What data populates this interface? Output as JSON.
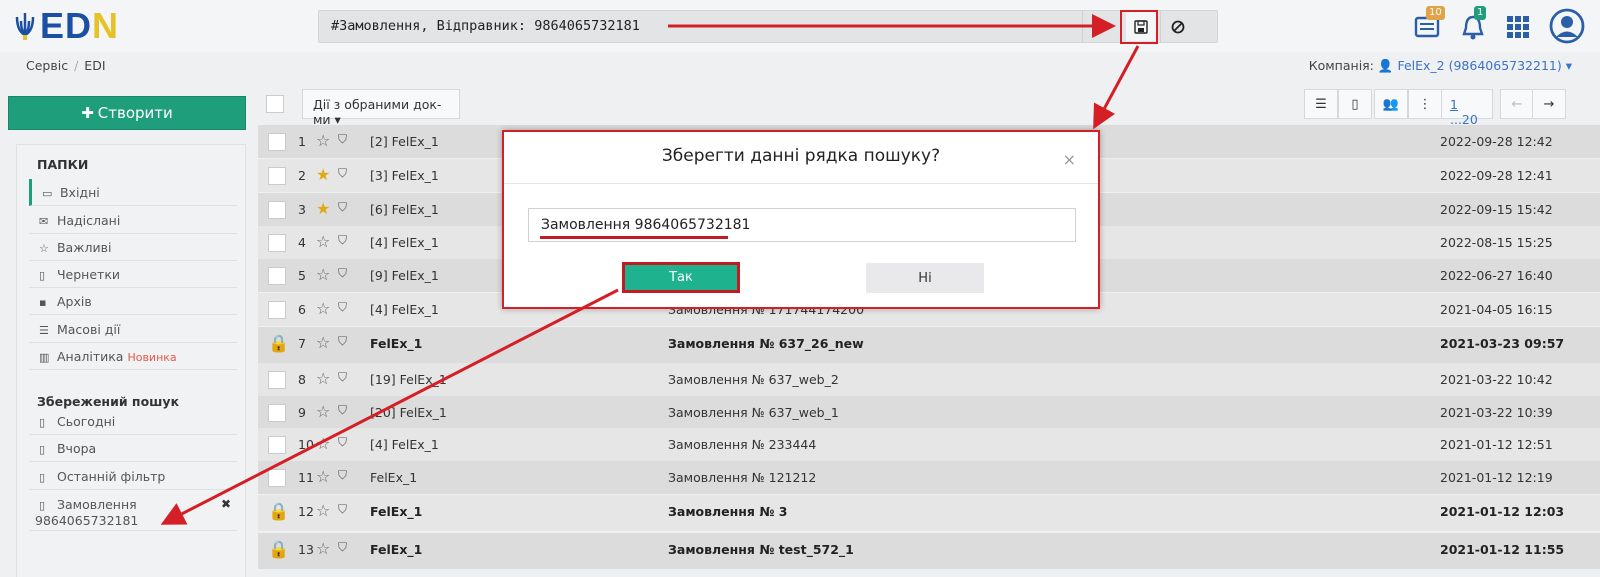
{
  "logo": {
    "text_a": "ED",
    "text_b": "N"
  },
  "search": {
    "query": "#Замовлення, Відправник: 9864065732181"
  },
  "notifications": {
    "docs_count": "10",
    "alerts_count": "1"
  },
  "breadcrumb": {
    "items": [
      "Сервіс",
      "EDI"
    ]
  },
  "company": {
    "label": "Компанія:",
    "value": "FelEx_2 (9864065732211)"
  },
  "sidebar": {
    "create_label": "Створити",
    "folders_title": "ПАПКИ",
    "folders": [
      {
        "label": "Вхідні",
        "icon": "inbox-icon"
      },
      {
        "label": "Надіслані",
        "icon": "envelope-icon"
      },
      {
        "label": "Важливі",
        "icon": "star-icon"
      },
      {
        "label": "Чернетки",
        "icon": "draft-icon"
      },
      {
        "label": "Архів",
        "icon": "archive-icon"
      },
      {
        "label": "Масові дії",
        "icon": "list-icon"
      },
      {
        "label": "Аналітика",
        "icon": "chart-icon",
        "badge": "Новинка"
      }
    ],
    "saved_title": "Збережений пошук",
    "saved": [
      {
        "label": "Сьогодні"
      },
      {
        "label": "Вчора"
      },
      {
        "label": "Останній фільтр"
      },
      {
        "label": "Замовлення",
        "label2": "9864065732181"
      }
    ]
  },
  "toolbar": {
    "actions_label": "Дії з обраними док-ми",
    "pager": "1 ...20"
  },
  "rows": [
    {
      "num": "1",
      "sender": "[2] FelEx_1",
      "subject": "",
      "date": "2022-09-28 12:42",
      "starred": false,
      "locked": false
    },
    {
      "num": "2",
      "sender": "[3] FelEx_1",
      "subject": "",
      "date": "2022-09-28 12:41",
      "starred": true,
      "locked": false
    },
    {
      "num": "3",
      "sender": "[6] FelEx_1",
      "subject": "",
      "date": "2022-09-15 15:42",
      "starred": true,
      "locked": false
    },
    {
      "num": "4",
      "sender": "[4] FelEx_1",
      "subject": "",
      "date": "2022-08-15 15:25",
      "starred": false,
      "locked": false
    },
    {
      "num": "5",
      "sender": "[9] FelEx_1",
      "subject": "",
      "date": "2022-06-27 16:40",
      "starred": false,
      "locked": false
    },
    {
      "num": "6",
      "sender": "[4] FelEx_1",
      "subject": "Замовлення № 1717441742​00",
      "date": "2021-04-05 16:15",
      "starred": false,
      "locked": false
    },
    {
      "num": "7",
      "sender": "FelEx_1",
      "subject": "Замовлення № 637_26_new",
      "date": "2021-03-23 09:57",
      "starred": false,
      "locked": true
    },
    {
      "num": "8",
      "sender": "[19] FelEx_1",
      "subject": "Замовлення № 637_web_2",
      "date": "2021-03-22 10:42",
      "starred": false,
      "locked": false
    },
    {
      "num": "9",
      "sender": "[20] FelEx_1",
      "subject": "Замовлення № 637_web_1",
      "date": "2021-03-22 10:39",
      "starred": false,
      "locked": false
    },
    {
      "num": "10",
      "sender": "[4] FelEx_1",
      "subject": "Замовлення № 233444",
      "date": "2021-01-12 12:51",
      "starred": false,
      "locked": false
    },
    {
      "num": "11",
      "sender": "FelEx_1",
      "subject": "Замовлення № 121212",
      "date": "2021-01-12 12:19",
      "starred": false,
      "locked": false
    },
    {
      "num": "12",
      "sender": "FelEx_1",
      "subject": "Замовлення № 3",
      "date": "2021-01-12 12:03",
      "starred": false,
      "locked": true
    },
    {
      "num": "13",
      "sender": "FelEx_1",
      "subject": "Замовлення № test_572_1",
      "date": "2021-01-12 11:55",
      "starred": false,
      "locked": true
    }
  ],
  "modal": {
    "title": "Зберегти данні рядка пошуку?",
    "input_value": "Замовлення 9864065732181",
    "yes_label": "Так",
    "no_label": "Ні",
    "close": "×"
  },
  "annotation_color": "#d51f26"
}
